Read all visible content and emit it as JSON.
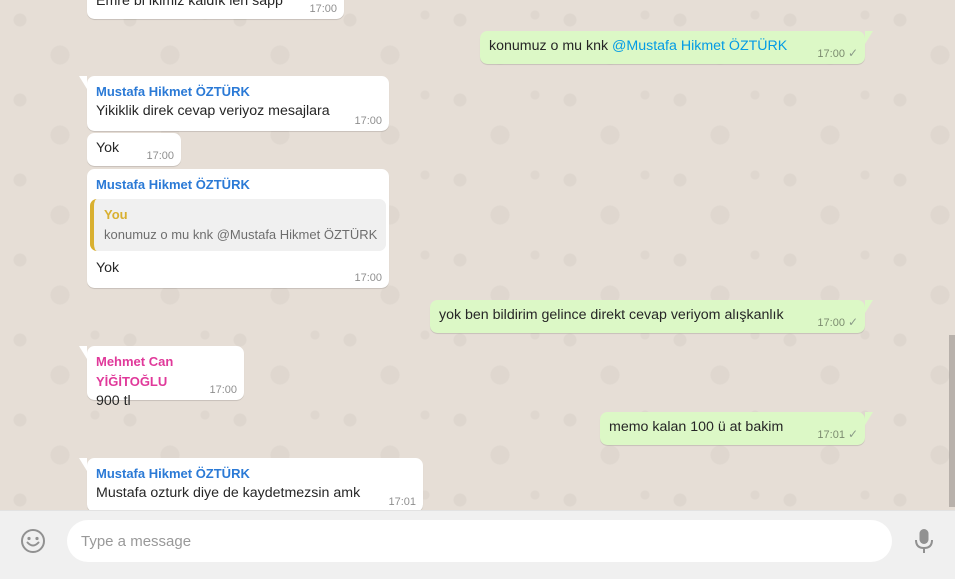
{
  "colors": {
    "incoming_bubble": "#ffffff",
    "outgoing_bubble": "#dcf8c6",
    "sender_mustafa": "#2b7ad6",
    "sender_mehmet": "#e0399a",
    "quote_author": "#d9b030",
    "mention": "#039be5"
  },
  "messages": [
    {
      "text": "Emre bi ikimiz kaldık len sapp",
      "time": "17:00"
    },
    {
      "text": "konumuz o mu knk ",
      "mention": "@Mustafa Hikmet ÖZTÜRK",
      "time": "17:00",
      "tick": "✓"
    },
    {
      "sender": "Mustafa Hikmet ÖZTÜRK",
      "text": "Yikiklik direk cevap veriyoz mesajlara",
      "time": "17:00"
    },
    {
      "text": "Yok",
      "time": "17:00"
    },
    {
      "sender": "Mustafa Hikmet ÖZTÜRK",
      "quote_author": "You",
      "quote_text": "konumuz o mu knk @Mustafa Hikmet ÖZTÜRK",
      "text": "Yok",
      "time": "17:00"
    },
    {
      "text": "yok ben bildirim gelince direkt cevap veriyom alışkanlık",
      "time": "17:00",
      "tick": "✓"
    },
    {
      "sender": "Mehmet Can YİĞİTOĞLU",
      "text": "900 tl",
      "time": "17:00"
    },
    {
      "text": "memo kalan 100 ü at bakim",
      "time": "17:01",
      "tick": "✓"
    },
    {
      "sender": "Mustafa Hikmet ÖZTÜRK",
      "text": "Mustafa ozturk diye de kaydetmezsin amk",
      "time": "17:01"
    }
  ],
  "composer": {
    "placeholder": "Type a message",
    "emoji_icon": "smiley-icon",
    "mic_icon": "microphone-icon"
  }
}
